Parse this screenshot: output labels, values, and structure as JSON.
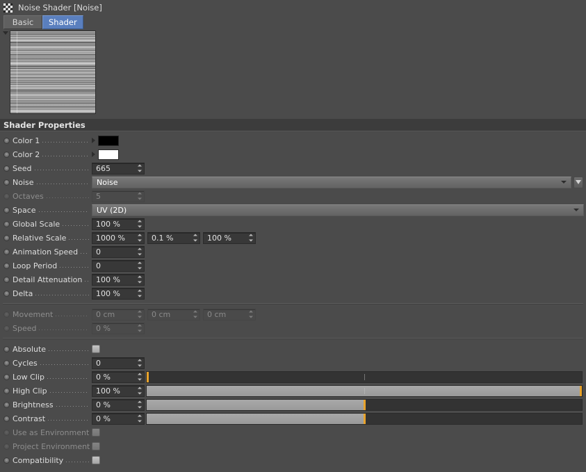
{
  "window": {
    "title": "Noise Shader [Noise]",
    "icon": "checkerboard-icon"
  },
  "tabs": [
    {
      "label": "Basic",
      "selected": false
    },
    {
      "label": "Shader",
      "selected": true
    }
  ],
  "preview": {
    "collapse_icon": "triangle-down-icon",
    "description": "noise-texture-preview"
  },
  "group_header": "Shader Properties",
  "properties": {
    "color1": {
      "label": "Color 1",
      "value_hex": "#000000"
    },
    "color2": {
      "label": "Color 2",
      "value_hex": "#ffffff"
    },
    "seed": {
      "label": "Seed",
      "value": "665"
    },
    "noise": {
      "label": "Noise",
      "value": "Noise"
    },
    "octaves": {
      "label": "Octaves",
      "value": "5"
    },
    "space": {
      "label": "Space",
      "value": "UV (2D)"
    },
    "global_scale": {
      "label": "Global Scale",
      "value": "100 %"
    },
    "relative_scale": {
      "label": "Relative Scale",
      "value_x": "1000 %",
      "value_y": "0.1 %",
      "value_z": "100 %"
    },
    "animation_speed": {
      "label": "Animation Speed",
      "value": "0"
    },
    "loop_period": {
      "label": "Loop Period",
      "value": "0"
    },
    "detail_attenuation": {
      "label": "Detail Attenuation",
      "value": "100 %"
    },
    "delta": {
      "label": "Delta",
      "value": "100 %"
    },
    "movement": {
      "label": "Movement",
      "value_x": "0 cm",
      "value_y": "0 cm",
      "value_z": "0 cm"
    },
    "speed": {
      "label": "Speed",
      "value": "0 %"
    },
    "absolute": {
      "label": "Absolute",
      "checked": false
    },
    "cycles": {
      "label": "Cycles",
      "value": "0"
    },
    "low_clip": {
      "label": "Low Clip",
      "value": "0 %",
      "percent": 0
    },
    "high_clip": {
      "label": "High Clip",
      "value": "100 %",
      "percent": 100
    },
    "brightness": {
      "label": "Brightness",
      "value": "0 %",
      "percent": 50
    },
    "contrast": {
      "label": "Contrast",
      "value": "0 %",
      "percent": 50
    },
    "use_as_environment": {
      "label": "Use as Environment",
      "checked": false
    },
    "project_environment": {
      "label": "Project Environment",
      "checked": false
    },
    "compatibility": {
      "label": "Compatibility",
      "checked": false
    }
  },
  "colors": {
    "accent_slider": "#e8a32b",
    "tab_selected": "#5a7fbe",
    "panel_bg": "#4b4b4b",
    "header_bg": "#3c3c3c"
  }
}
